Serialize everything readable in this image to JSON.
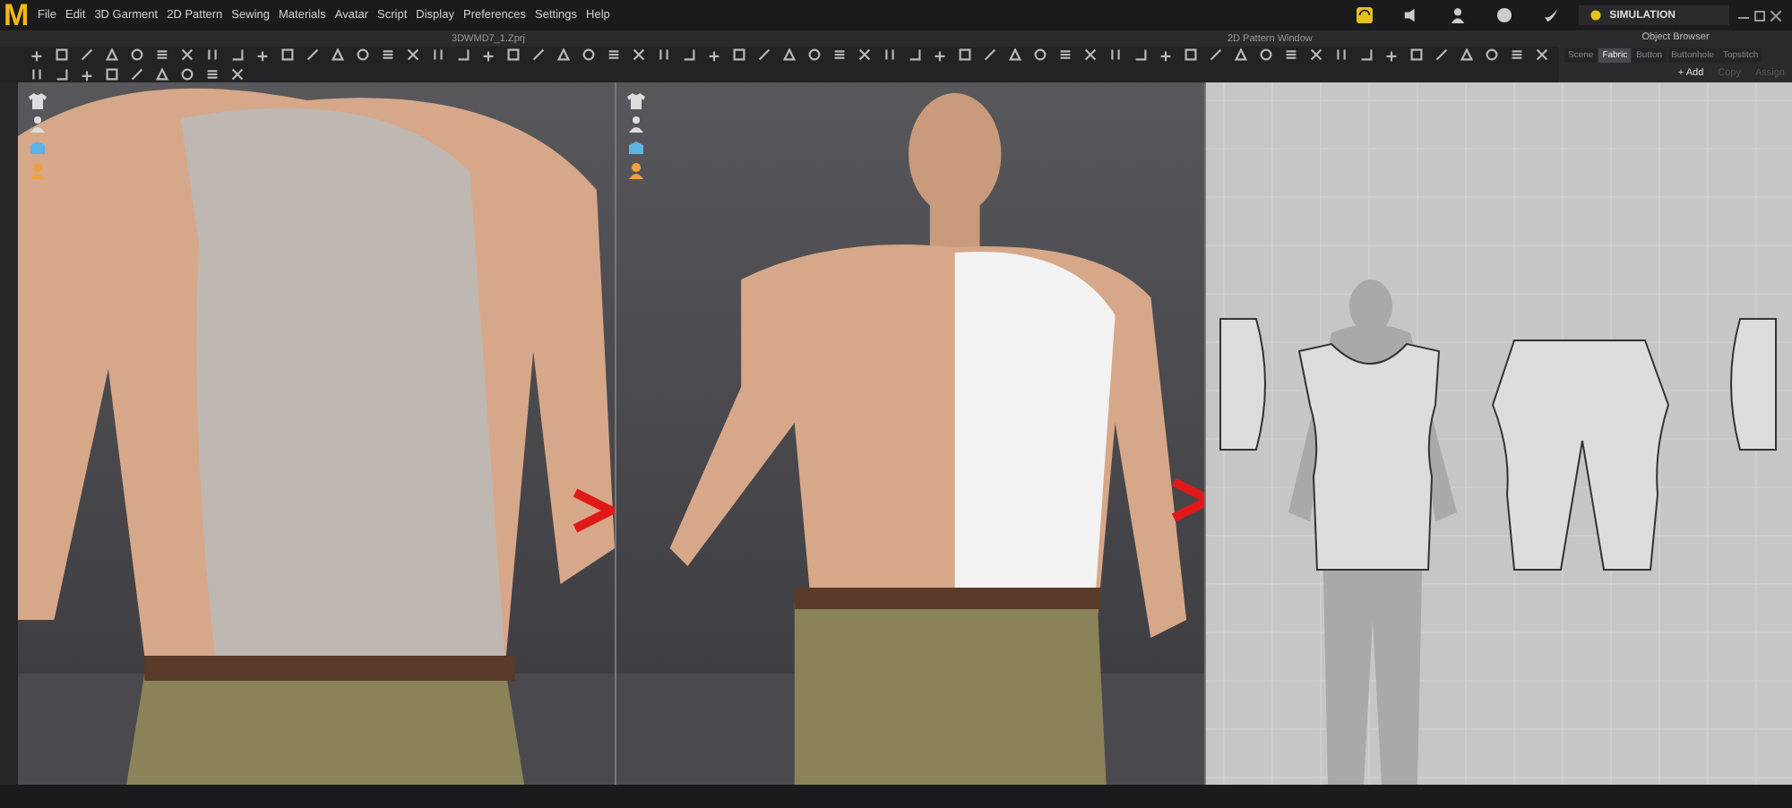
{
  "menu": {
    "logo": "M",
    "items": [
      "File",
      "Edit",
      "3D Garment",
      "2D Pattern",
      "Sewing",
      "Materials",
      "Avatar",
      "Script",
      "Display",
      "Preferences",
      "Settings",
      "Help"
    ]
  },
  "mode_button": {
    "label": "SIMULATION"
  },
  "viewport_3d": {
    "title": "3DWMD7_1.Zprj"
  },
  "pattern_window": {
    "title": "2D Pattern Window"
  },
  "object_browser": {
    "title": "Object Browser",
    "tabs": [
      {
        "label": "Scene",
        "selected": false
      },
      {
        "label": "Fabric",
        "selected": true
      },
      {
        "label": "Button",
        "selected": false
      },
      {
        "label": "Buttonhole",
        "selected": false
      },
      {
        "label": "Topstitch",
        "selected": false
      }
    ],
    "actions": [
      {
        "label": "+ Add",
        "disabled": false
      },
      {
        "label": "Copy",
        "disabled": true
      },
      {
        "label": "Assign",
        "disabled": true
      }
    ]
  }
}
